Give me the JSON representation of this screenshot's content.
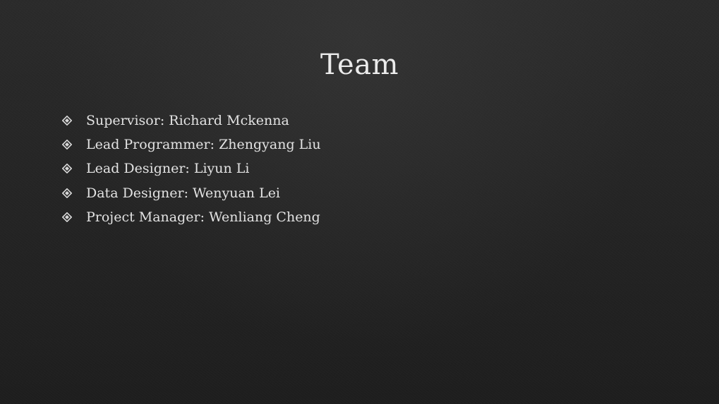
{
  "slide": {
    "title": "Team",
    "bullet_icon": "diamond-bullet-icon",
    "colors": {
      "background": "#262626",
      "text": "#e3e3e3",
      "title": "#ebebeb"
    },
    "items": [
      {
        "text": "Supervisor: Richard Mckenna"
      },
      {
        "text": "Lead Programmer: Zhengyang Liu"
      },
      {
        "text": "Lead Designer: Liyun Li"
      },
      {
        "text": "Data Designer: Wenyuan Lei"
      },
      {
        "text": "Project Manager: Wenliang Cheng"
      }
    ]
  }
}
